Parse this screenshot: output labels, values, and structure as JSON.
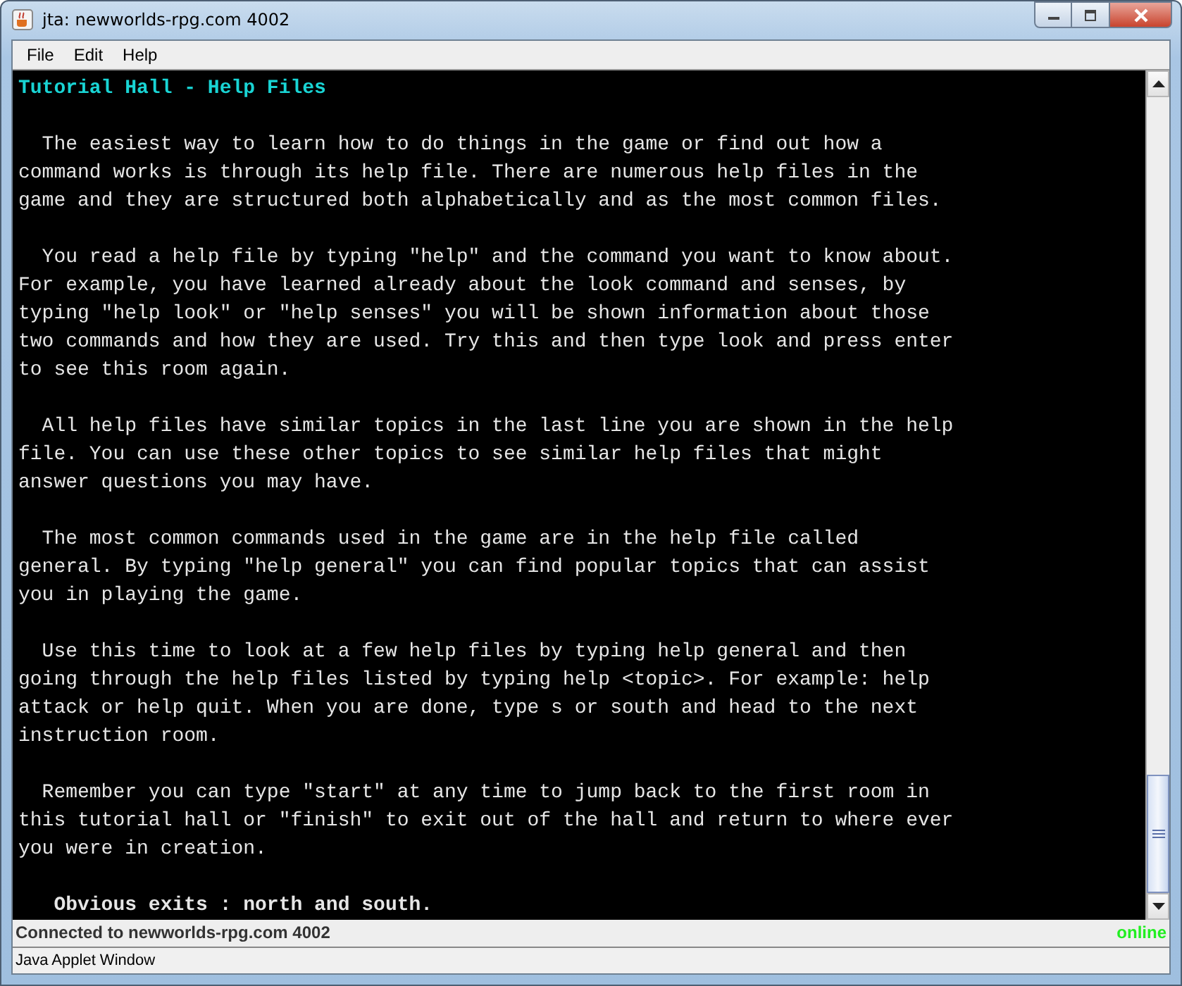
{
  "window": {
    "title": "jta: newworlds-rpg.com 4002"
  },
  "menu": [
    {
      "label": "File"
    },
    {
      "label": "Edit"
    },
    {
      "label": "Help"
    }
  ],
  "terminal": [
    {
      "kind": "heading",
      "text": "Tutorial Hall - Help Files"
    },
    {
      "kind": "paragraph",
      "text": "  The easiest way to learn how to do things in the game or find out how a\ncommand works is through its help file. There are numerous help files in the\ngame and they are structured both alphabetically and as the most common files."
    },
    {
      "kind": "paragraph",
      "text": "  You read a help file by typing \"help\" and the command you want to know about.\nFor example, you have learned already about the look command and senses, by\ntyping \"help look\" or \"help senses\" you will be shown information about those\ntwo commands and how they are used. Try this and then type look and press enter\nto see this room again."
    },
    {
      "kind": "paragraph",
      "text": "  All help files have similar topics in the last line you are shown in the help\nfile. You can use these other topics to see similar help files that might\nanswer questions you may have."
    },
    {
      "kind": "paragraph",
      "text": "  The most common commands used in the game are in the help file called\ngeneral. By typing \"help general\" you can find popular topics that can assist\nyou in playing the game."
    },
    {
      "kind": "paragraph",
      "text": "  Use this time to look at a few help files by typing help general and then\ngoing through the help files listed by typing help <topic>. For example: help\nattack or help quit. When you are done, type s or south and head to the next\ninstruction room."
    },
    {
      "kind": "paragraph",
      "text": "  Remember you can type \"start\" at any time to jump back to the first room in\nthis tutorial hall or \"finish\" to exit out of the hall and return to where ever\nyou were in creation."
    },
    {
      "kind": "exits",
      "text": "   Obvious exits : north and south."
    }
  ],
  "status_bar": {
    "message": "Connected to newworlds-rpg.com 4002",
    "state": "online",
    "online": true
  },
  "applet_bar": {
    "text": "Java Applet Window"
  }
}
